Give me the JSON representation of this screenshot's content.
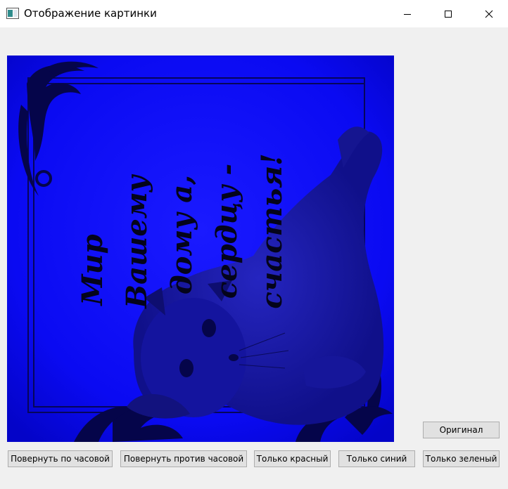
{
  "window": {
    "title": "Отображение картинки",
    "icons": {
      "app": "image-window-icon",
      "minimize": "minimize-icon",
      "maximize": "maximize-icon",
      "close": "close-icon"
    }
  },
  "image": {
    "caption_lines": [
      "Мир",
      "Вашему",
      "дому а,",
      "сердцу -",
      "счастья!"
    ],
    "tint_color": "#0000ff",
    "dark_color": "#04041a"
  },
  "buttons": {
    "original": "Оригинал",
    "rotate_cw": "Повернуть по часовой",
    "rotate_ccw": "Повернуть против часовой",
    "only_red": "Только красный",
    "only_blue": "Только синий",
    "only_green": "Только зеленый"
  }
}
